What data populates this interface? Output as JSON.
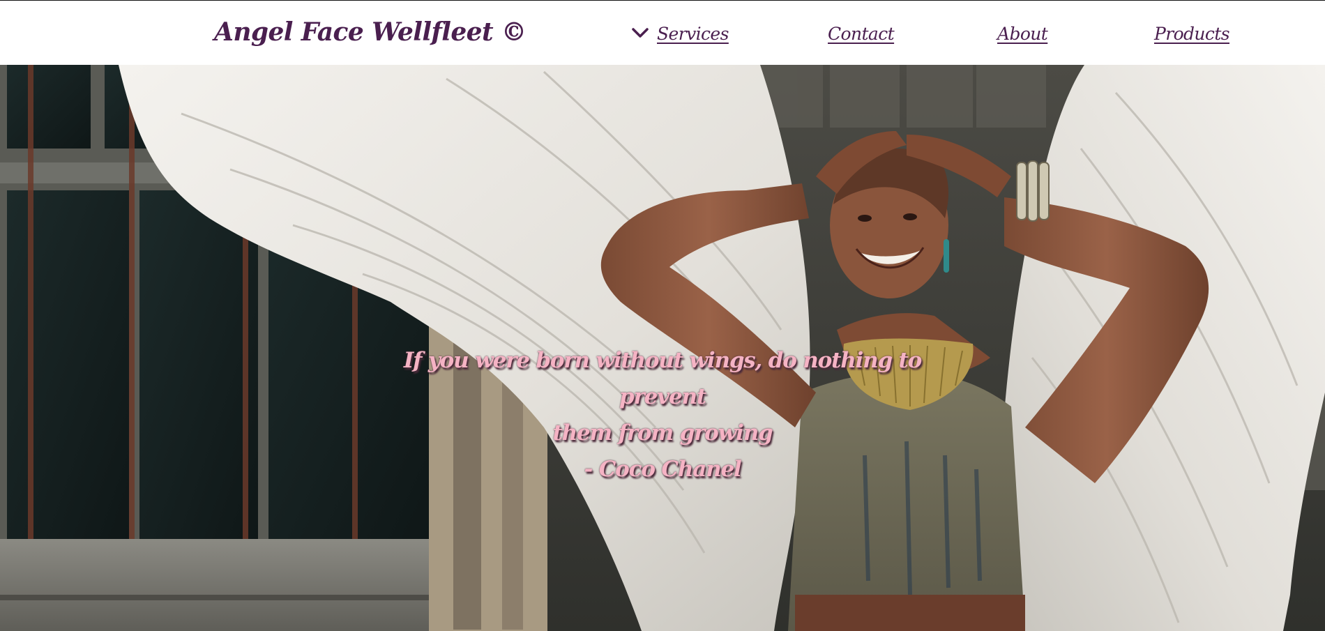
{
  "header": {
    "brand": "Angel Face Wellfleet ©",
    "nav": {
      "services_label": "Services",
      "contact_label": "Contact",
      "about_label": "About",
      "products_label": "Products"
    }
  },
  "hero": {
    "quote_line_1": "If you were born without wings, do nothing to prevent",
    "quote_line_2": "them from growing",
    "quote_author": "- Coco Chanel"
  },
  "colors": {
    "brand": "#4a1f4f",
    "quote_text": "#f5b3c4",
    "quote_shadow": "#4b2a3a",
    "header_bg": "#ffffff"
  },
  "icons": {
    "dropdown": "chevron-down-icon"
  }
}
